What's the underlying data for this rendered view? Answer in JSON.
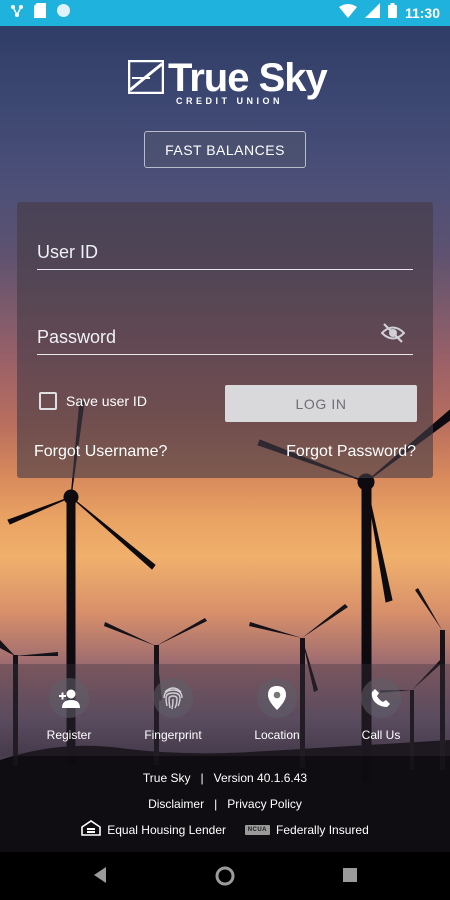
{
  "status_bar": {
    "time": "11:30",
    "left_icons": [
      "network-share-icon",
      "sd-card-icon",
      "circle-notification-icon"
    ],
    "right_icons": [
      "wifi-icon",
      "cell-signal-icon",
      "battery-icon"
    ],
    "color": "#1fb2dc"
  },
  "brand": {
    "name": "True Sky",
    "tagline": "CREDIT UNION",
    "trademark": "™"
  },
  "fast_balances_label": "FAST BALANCES",
  "login": {
    "user_id_placeholder": "User ID",
    "password_placeholder": "Password",
    "save_user_id_label": "Save user ID",
    "login_button_label": "LOG IN",
    "forgot_username": "Forgot Username?",
    "forgot_password": "Forgot Password?",
    "save_user_checked": false
  },
  "actions": [
    {
      "label": "Register",
      "icon": "person-add-icon"
    },
    {
      "label": "Fingerprint",
      "icon": "fingerprint-icon"
    },
    {
      "label": "Location",
      "icon": "location-pin-icon"
    },
    {
      "label": "Call Us",
      "icon": "phone-icon"
    }
  ],
  "footer": {
    "app_name": "True Sky",
    "separator": "|",
    "version": "Version 40.1.6.43",
    "disclaimer": "Disclaimer",
    "privacy": "Privacy Policy",
    "equal_housing": "Equal Housing Lender",
    "ncua": "NCUA",
    "insured": "Federally Insured"
  },
  "nav": [
    "back-icon",
    "home-icon",
    "recents-icon"
  ]
}
